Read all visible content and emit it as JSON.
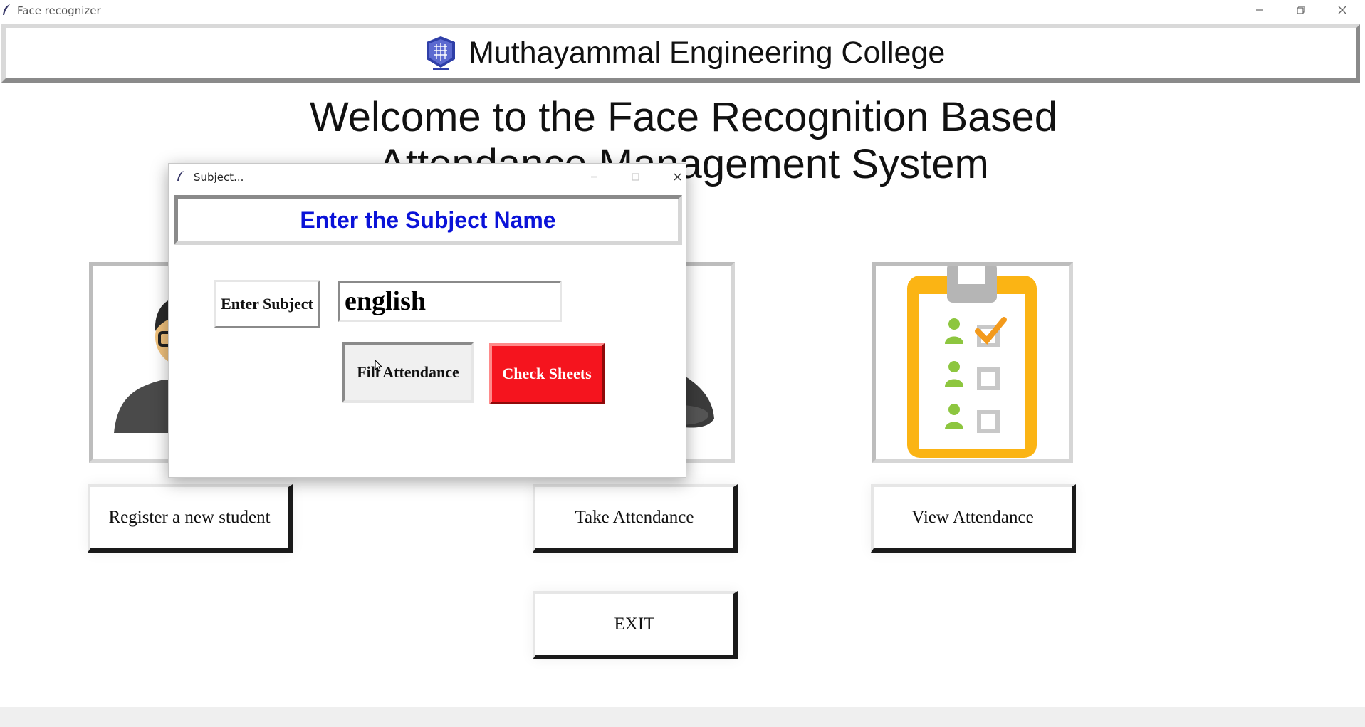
{
  "main_window": {
    "title": "Face recognizer",
    "icon": "feather-icon",
    "controls": [
      "minimize-icon",
      "restore-icon",
      "close-icon"
    ]
  },
  "banner": {
    "logo_icon": "college-logo-icon",
    "college_name": "Muthayammal Engineering College"
  },
  "welcome": {
    "line1": "Welcome to the Face Recognition Based",
    "line2": "Attendance Management System"
  },
  "panels": [
    {
      "icon": "student-avatar-icon"
    },
    {
      "icon": "attendance-camera-icon"
    },
    {
      "icon": "clipboard-checklist-icon"
    }
  ],
  "buttons": {
    "register": "Register a new student",
    "take_attendance": "Take Attendance",
    "view_attendance": "View Attendance",
    "exit": "EXIT"
  },
  "dialog": {
    "title": "Subject...",
    "header": "Enter the Subject Name",
    "subject_label": "Enter Subject",
    "subject_value": "english",
    "fill_button": "Fill Attendance",
    "check_button": "Check Sheets",
    "colors": {
      "header_text": "#0a12d8",
      "check_button_bg": "#f5141e",
      "check_button_text": "#ffffff"
    }
  }
}
